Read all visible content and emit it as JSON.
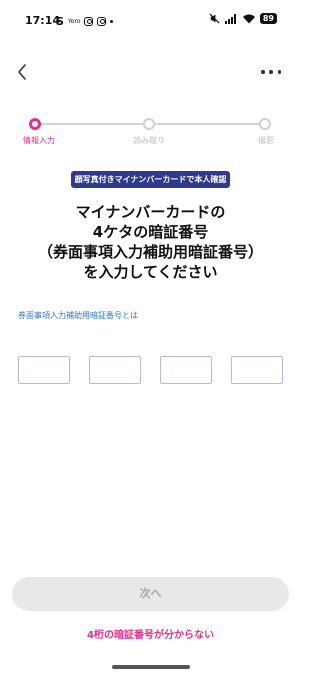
{
  "status_bar": {
    "time": "17:14",
    "left_icons": [
      "S",
      "Yoro",
      "instagram-icon",
      "instagram-icon",
      "dot"
    ],
    "battery": "89"
  },
  "nav": {
    "back_icon": "chevron-left-icon",
    "more_icon": "more-horizontal-icon"
  },
  "stepper": {
    "steps": [
      {
        "label": "情報入力",
        "state": "active"
      },
      {
        "label": "読み取り",
        "state": "inactive"
      },
      {
        "label": "撮影",
        "state": "inactive"
      }
    ],
    "active_color": "#e0308f"
  },
  "badge": {
    "text": "顔写真付きマイナンバーカードで本人確認",
    "color": "#2f3a8a"
  },
  "title": {
    "lines": [
      "マイナンバーカードの",
      "4ケタの暗証番号",
      "（券面事項入力補助用暗証番号）",
      "を入力してください"
    ]
  },
  "pin_help_link": "券面事項入力補助用暗証番号とは",
  "pin": {
    "digits": [
      "",
      "",
      "",
      ""
    ]
  },
  "next_button": {
    "label": "次へ",
    "enabled": false
  },
  "forgot_link": "4桁の暗証番号が分からない"
}
